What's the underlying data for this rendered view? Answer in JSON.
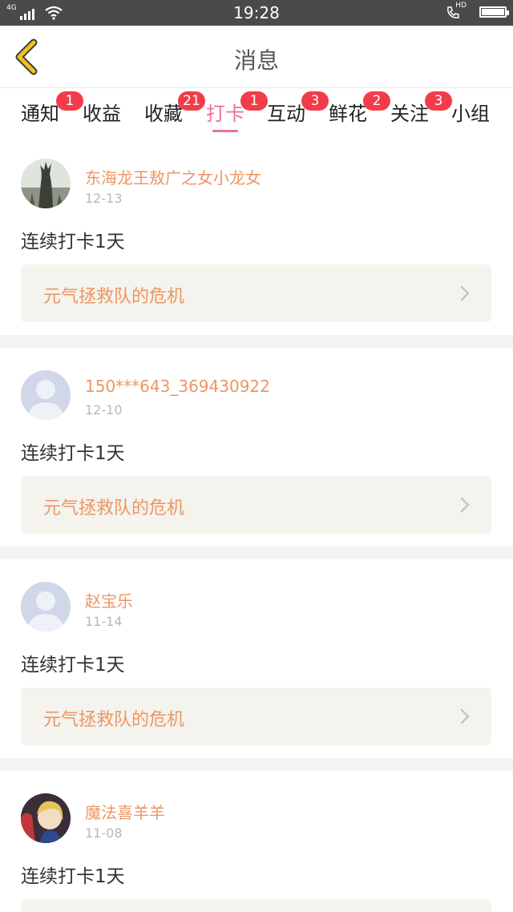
{
  "status_bar": {
    "network": "4G",
    "time": "19:28",
    "call_label": "HD"
  },
  "header": {
    "title": "消息"
  },
  "tabs": [
    {
      "label": "通知",
      "badge": "1"
    },
    {
      "label": "收益",
      "badge": ""
    },
    {
      "label": "收藏",
      "badge": "21"
    },
    {
      "label": "打卡",
      "badge": "1",
      "active": true
    },
    {
      "label": "互动",
      "badge": "3"
    },
    {
      "label": "鲜花",
      "badge": "2"
    },
    {
      "label": "关注",
      "badge": "3"
    },
    {
      "label": "小组",
      "badge": ""
    }
  ],
  "items": [
    {
      "username": "东海龙王敖广之女小龙女",
      "date": "12-13",
      "text": "连续打卡1天",
      "book": "元气拯救队的危机",
      "avatar": "statue-photo-avatar"
    },
    {
      "username": "150***643_369430922",
      "date": "12-10",
      "text": "连续打卡1天",
      "book": "元气拯救队的危机",
      "avatar": "default-user-avatar"
    },
    {
      "username": "赵宝乐",
      "date": "11-14",
      "text": "连续打卡1天",
      "book": "元气拯救队的危机",
      "avatar": "default-user-avatar"
    },
    {
      "username": "魔法喜羊羊",
      "date": "11-08",
      "text": "连续打卡1天",
      "book": "",
      "avatar": "anime-avatar"
    }
  ],
  "colors": {
    "accent": "#e9729a",
    "name": "#ec9664",
    "badge": "#f23c4c",
    "back_icon": "#f2c21a"
  }
}
